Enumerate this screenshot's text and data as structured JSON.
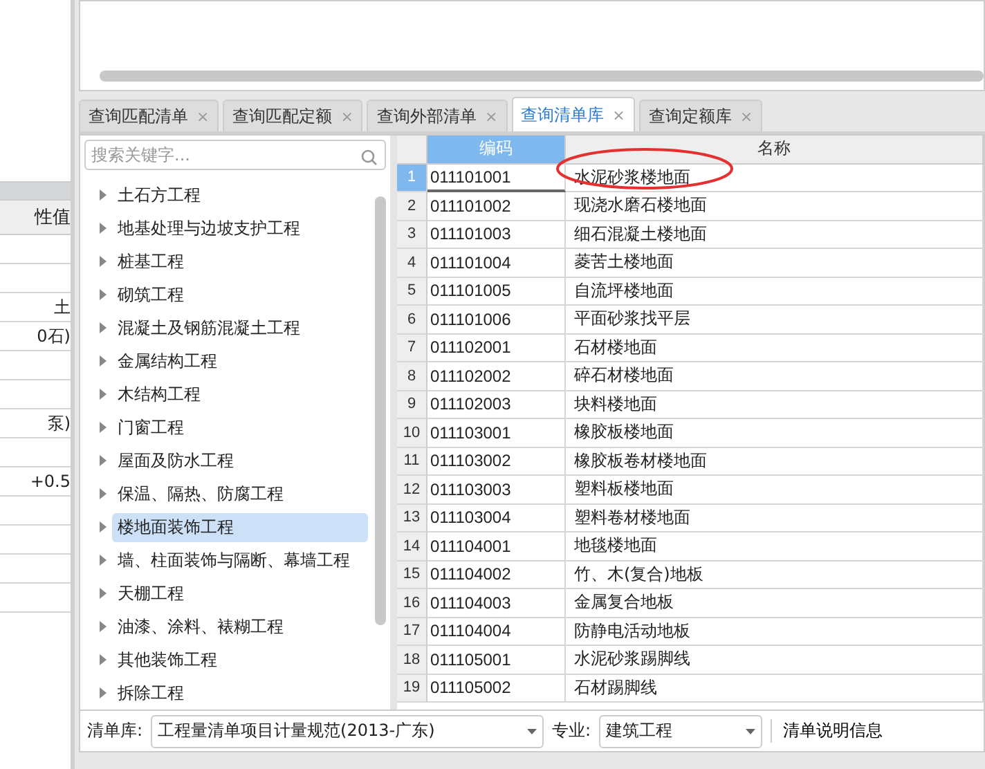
{
  "side_panel": {
    "column_header": "性值",
    "rows": [
      {},
      {},
      {
        "value": "土"
      },
      {
        "value": "0石)"
      },
      {},
      {},
      {
        "value": "泵)"
      },
      {},
      {
        "value": "+0.5"
      },
      {},
      {},
      {},
      {}
    ]
  },
  "tabs": [
    {
      "label": "查询匹配清单",
      "close": "×",
      "selected": false
    },
    {
      "label": "查询匹配定额",
      "close": "×",
      "selected": false
    },
    {
      "label": "查询外部清单",
      "close": "×",
      "selected": false
    },
    {
      "label": "查询清单库",
      "close": "×",
      "selected": true
    },
    {
      "label": "查询定额库",
      "close": "×",
      "selected": false
    }
  ],
  "search": {
    "placeholder": "搜索关键字..."
  },
  "tree": [
    {
      "label": "土石方工程",
      "selected": false
    },
    {
      "label": "地基处理与边坡支护工程",
      "selected": false
    },
    {
      "label": "桩基工程",
      "selected": false
    },
    {
      "label": "砌筑工程",
      "selected": false
    },
    {
      "label": "混凝土及钢筋混凝土工程",
      "selected": false
    },
    {
      "label": "金属结构工程",
      "selected": false
    },
    {
      "label": "木结构工程",
      "selected": false
    },
    {
      "label": "门窗工程",
      "selected": false
    },
    {
      "label": "屋面及防水工程",
      "selected": false
    },
    {
      "label": "保温、隔热、防腐工程",
      "selected": false
    },
    {
      "label": "楼地面装饰工程",
      "selected": true
    },
    {
      "label": "墙、柱面装饰与隔断、幕墙工程",
      "selected": false
    },
    {
      "label": "天棚工程",
      "selected": false
    },
    {
      "label": "油漆、涂料、裱糊工程",
      "selected": false
    },
    {
      "label": "其他装饰工程",
      "selected": false
    },
    {
      "label": "拆除工程",
      "selected": false
    }
  ],
  "table": {
    "columns": [
      "编码",
      "名称"
    ],
    "rows": [
      {
        "index": "1",
        "code": "011101001",
        "name": "水泥砂浆楼地面",
        "selected": true
      },
      {
        "index": "2",
        "code": "011101002",
        "name": "现浇水磨石楼地面",
        "selected": false
      },
      {
        "index": "3",
        "code": "011101003",
        "name": "细石混凝土楼地面",
        "selected": false
      },
      {
        "index": "4",
        "code": "011101004",
        "name": "菱苦土楼地面",
        "selected": false
      },
      {
        "index": "5",
        "code": "011101005",
        "name": "自流坪楼地面",
        "selected": false
      },
      {
        "index": "6",
        "code": "011101006",
        "name": "平面砂浆找平层",
        "selected": false
      },
      {
        "index": "7",
        "code": "011102001",
        "name": "石材楼地面",
        "selected": false
      },
      {
        "index": "8",
        "code": "011102002",
        "name": "碎石材楼地面",
        "selected": false
      },
      {
        "index": "9",
        "code": "011102003",
        "name": "块料楼地面",
        "selected": false
      },
      {
        "index": "10",
        "code": "011103001",
        "name": "橡胶板楼地面",
        "selected": false
      },
      {
        "index": "11",
        "code": "011103002",
        "name": "橡胶板卷材楼地面",
        "selected": false
      },
      {
        "index": "12",
        "code": "011103003",
        "name": "塑料板楼地面",
        "selected": false
      },
      {
        "index": "13",
        "code": "011103004",
        "name": "塑料卷材楼地面",
        "selected": false
      },
      {
        "index": "14",
        "code": "011104001",
        "name": "地毯楼地面",
        "selected": false
      },
      {
        "index": "15",
        "code": "011104002",
        "name": "竹、木(复合)地板",
        "selected": false
      },
      {
        "index": "16",
        "code": "011104003",
        "name": "金属复合地板",
        "selected": false
      },
      {
        "index": "17",
        "code": "011104004",
        "name": "防静电活动地板",
        "selected": false
      },
      {
        "index": "18",
        "code": "011105001",
        "name": "水泥砂浆踢脚线",
        "selected": false
      },
      {
        "index": "19",
        "code": "011105002",
        "name": "石材踢脚线",
        "selected": false
      }
    ]
  },
  "bottom_bar": {
    "library_label": "清单库:",
    "library_value": "工程量清单项目计量规范(2013-广东)",
    "specialty_label": "专业:",
    "specialty_value": "建筑工程",
    "info_button": "清单说明信息"
  }
}
